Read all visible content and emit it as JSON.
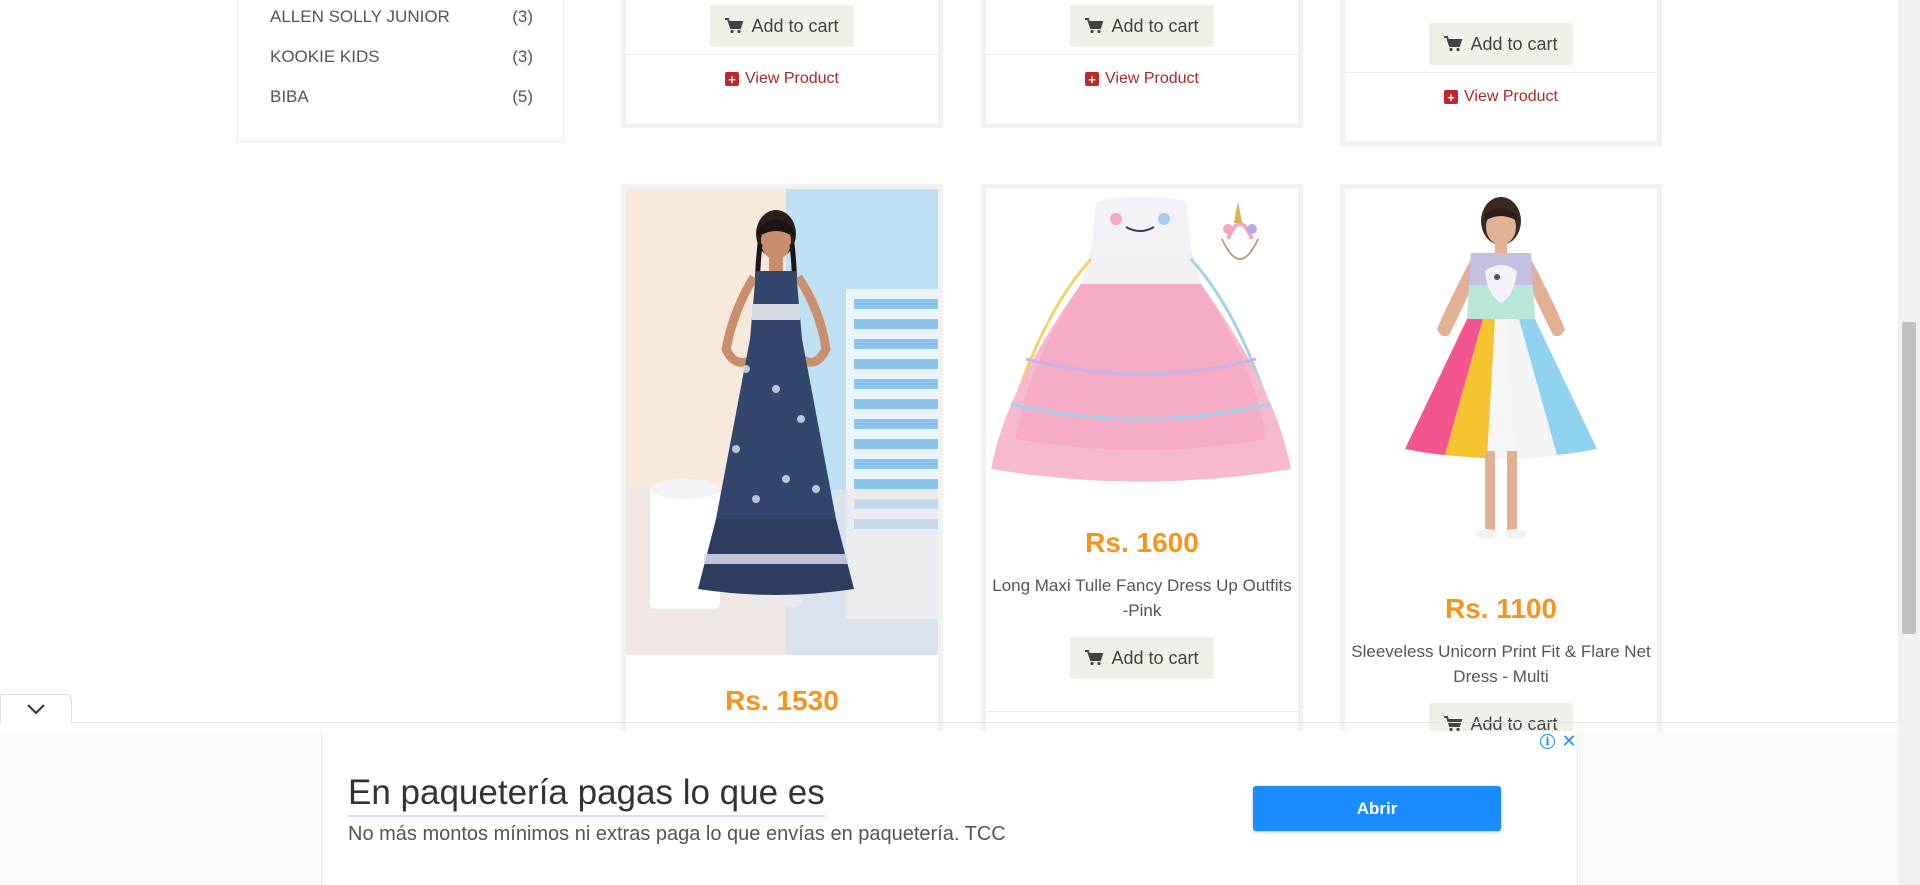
{
  "brands": [
    {
      "name": "ALLEN SOLLY JUNIOR",
      "count": "(3)"
    },
    {
      "name": "KOOKIE KIDS",
      "count": "(3)"
    },
    {
      "name": "BIBA",
      "count": "(5)"
    }
  ],
  "top_cards": [
    {
      "cart_label": "Add to cart",
      "view_label": "View Product"
    },
    {
      "cart_label": "Add to cart",
      "view_label": "View Product"
    },
    {
      "cart_label": "Add to cart",
      "view_label": "View Product"
    }
  ],
  "products": [
    {
      "price": "Rs. 1530",
      "name": "",
      "cart_label": ""
    },
    {
      "price": "Rs. 1600",
      "name": "Long Maxi Tulle Fancy Dress Up Outfits -Pink",
      "cart_label": "Add to cart"
    },
    {
      "price": "Rs. 1100",
      "name": "Sleeveless Unicorn Print Fit & Flare Net Dress - Multi",
      "cart_label": "Add to cart"
    }
  ],
  "ad": {
    "headline": "En paquetería pagas lo que es",
    "description": "No más montos mínimos ni extras paga lo que envías en paquetería. TCC",
    "button_label": "Abrir",
    "info_glyph": "i",
    "close_glyph": "✕"
  },
  "colors": {
    "price": "#f7941d",
    "view_link": "#a52a2a",
    "ad_button": "#1a8cff"
  },
  "icons": [
    "cart-icon",
    "plus-square-icon",
    "chevron-down-icon",
    "info-icon",
    "close-icon"
  ]
}
